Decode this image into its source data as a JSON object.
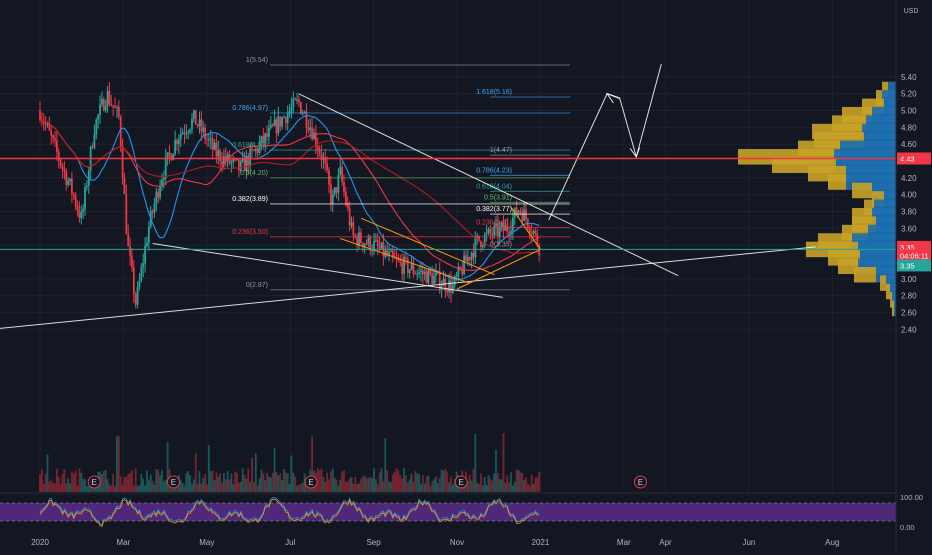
{
  "currency": "USD",
  "price_axis": {
    "ticks": [
      {
        "label": "5.40",
        "v": 5.4
      },
      {
        "label": "5.20",
        "v": 5.2
      },
      {
        "label": "5.00",
        "v": 5.0
      },
      {
        "label": "4.80",
        "v": 4.8
      },
      {
        "label": "4.60",
        "v": 4.6
      },
      {
        "label": "4.20",
        "v": 4.2
      },
      {
        "label": "4.00",
        "v": 4.0
      },
      {
        "label": "3.80",
        "v": 3.8
      },
      {
        "label": "3.60",
        "v": 3.6
      },
      {
        "label": "3.40",
        "v": 3.4
      },
      {
        "label": "3.00",
        "v": 3.0
      },
      {
        "label": "2.80",
        "v": 2.8
      },
      {
        "label": "2.60",
        "v": 2.6
      },
      {
        "label": "2.40",
        "v": 2.4
      }
    ],
    "badges": [
      {
        "label": "4.43",
        "v": 4.43,
        "color": "#f23645"
      },
      {
        "label": "3.35",
        "v": 3.38,
        "color": "#f23645"
      },
      {
        "label": "04:06:11",
        "v": 3.28,
        "color": "#f23645"
      },
      {
        "label": "3.35",
        "v": 3.16,
        "color": "#26a69a"
      }
    ]
  },
  "time_axis": {
    "labels": [
      {
        "label": "2020",
        "m": 0
      },
      {
        "label": "Mar",
        "m": 2
      },
      {
        "label": "May",
        "m": 4
      },
      {
        "label": "Jul",
        "m": 6
      },
      {
        "label": "Sep",
        "m": 8
      },
      {
        "label": "Nov",
        "m": 10
      },
      {
        "label": "2021",
        "m": 12
      },
      {
        "label": "Mar",
        "m": 14
      },
      {
        "label": "Apr",
        "m": 15
      },
      {
        "label": "Jun",
        "m": 17
      },
      {
        "label": "Aug",
        "m": 19
      }
    ]
  },
  "rsi_axis": {
    "ticks": [
      {
        "label": "100.00",
        "v": 100
      },
      {
        "label": "0.00",
        "v": 0
      }
    ]
  },
  "fib_left": {
    "color": "#9598a1",
    "levels": [
      {
        "label": "1(5.54)",
        "v": 5.54,
        "color": "#9598a1"
      },
      {
        "label": "0.786(4.97)",
        "v": 4.97,
        "color": "#42a5f5"
      },
      {
        "label": "0.618(4.53)",
        "v": 4.53,
        "color": "#26a69a"
      },
      {
        "label": "0.5(4.20)",
        "v": 4.2,
        "color": "#66bb6a"
      },
      {
        "label": "0.382(3.89)",
        "v": 3.89,
        "color": "#ffffff"
      },
      {
        "label": "0.236(3.50)",
        "v": 3.5,
        "color": "#f23645"
      },
      {
        "label": "0(2.87)",
        "v": 2.87,
        "color": "#9598a1"
      }
    ]
  },
  "fib_right": {
    "levels": [
      {
        "label": "1.618(5.16)",
        "v": 5.16,
        "color": "#42a5f5"
      },
      {
        "label": "1(4.47)",
        "v": 4.47,
        "color": "#9598a1"
      },
      {
        "label": "0.786(4.23)",
        "v": 4.23,
        "color": "#42a5f5"
      },
      {
        "label": "0.618(4.04)",
        "v": 4.04,
        "color": "#26a69a"
      },
      {
        "label": "0.5(3.91)",
        "v": 3.91,
        "color": "#66bb6a"
      },
      {
        "label": "0.382(3.77)",
        "v": 3.77,
        "color": "#ffffff"
      },
      {
        "label": "0.236(3.61)",
        "v": 3.61,
        "color": "#f23645"
      },
      {
        "label": "0(3.35)",
        "v": 3.35,
        "color": "#9598a1"
      }
    ]
  },
  "horizontal_lines": [
    {
      "name": "resistance",
      "v": 4.43,
      "color": "#f23645"
    },
    {
      "name": "current-price",
      "v": 3.35,
      "color": "#26a69a"
    }
  ],
  "earnings_markers": {
    "label": "E",
    "months": [
      1.3,
      3.2,
      6.5,
      10.1,
      14.4
    ]
  },
  "colors": {
    "up": "#26a69a",
    "down": "#f23645",
    "bg": "#131722",
    "grid": "#1e222d",
    "axis_text": "#b2b5be",
    "ma_blue": "#2196f3",
    "ma_red": "#f23645",
    "ma_dark_red": "#b71c1c",
    "vp_gold": "#c9a227",
    "vp_blue": "#1e6fb0",
    "rsi_fill": "#5b2b8a"
  },
  "chart_data": {
    "type": "candlestick",
    "x_unit": "months since Jan 2020",
    "price_path": [
      [
        0,
        5.0
      ],
      [
        0.4,
        4.5
      ],
      [
        0.8,
        4.0
      ],
      [
        1.0,
        3.7
      ],
      [
        1.3,
        4.8
      ],
      [
        1.6,
        5.2
      ],
      [
        1.9,
        4.9
      ],
      [
        2.1,
        3.4
      ],
      [
        2.3,
        2.7
      ],
      [
        2.6,
        3.6
      ],
      [
        2.9,
        4.2
      ],
      [
        3.3,
        4.7
      ],
      [
        3.7,
        4.9
      ],
      [
        4.2,
        4.5
      ],
      [
        4.8,
        4.3
      ],
      [
        5.3,
        4.6
      ],
      [
        5.8,
        4.9
      ],
      [
        6.2,
        5.1
      ],
      [
        6.5,
        4.8
      ],
      [
        6.8,
        4.4
      ],
      [
        7.0,
        3.9
      ],
      [
        7.2,
        4.25
      ],
      [
        7.5,
        3.5
      ],
      [
        8.0,
        3.4
      ],
      [
        8.5,
        3.2
      ],
      [
        9.0,
        3.1
      ],
      [
        9.5,
        3.0
      ],
      [
        9.9,
        2.9
      ],
      [
        10.2,
        3.2
      ],
      [
        10.5,
        3.45
      ],
      [
        10.9,
        3.55
      ],
      [
        11.2,
        3.6
      ],
      [
        11.5,
        3.85
      ],
      [
        11.8,
        3.6
      ],
      [
        12.0,
        3.35
      ]
    ],
    "volume_profile": [
      {
        "v": 5.25,
        "buy": 6,
        "sell": 8
      },
      {
        "v": 5.15,
        "buy": 6,
        "sell": 14
      },
      {
        "v": 5.05,
        "buy": 22,
        "sell": 12
      },
      {
        "v": 4.95,
        "buy": 30,
        "sell": 24
      },
      {
        "v": 4.85,
        "buy": 34,
        "sell": 30
      },
      {
        "v": 4.75,
        "buy": 50,
        "sell": 34
      },
      {
        "v": 4.65,
        "buy": 50,
        "sell": 32
      },
      {
        "v": 4.55,
        "buy": 42,
        "sell": 56
      },
      {
        "v": 4.45,
        "buy": 96,
        "sell": 62
      },
      {
        "v": 4.35,
        "buy": 64,
        "sell": 60
      },
      {
        "v": 4.25,
        "buy": 38,
        "sell": 50
      },
      {
        "v": 4.15,
        "buy": 18,
        "sell": 50
      },
      {
        "v": 4.05,
        "buy": 20,
        "sell": 24
      },
      {
        "v": 3.95,
        "buy": 12,
        "sell": 12
      },
      {
        "v": 3.85,
        "buy": 10,
        "sell": 22
      },
      {
        "v": 3.75,
        "buy": 20,
        "sell": 24
      },
      {
        "v": 3.65,
        "buy": 24,
        "sell": 20
      },
      {
        "v": 3.55,
        "buy": 26,
        "sell": 28
      },
      {
        "v": 3.45,
        "buy": 34,
        "sell": 44
      },
      {
        "v": 3.35,
        "buy": 52,
        "sell": 38
      },
      {
        "v": 3.25,
        "buy": 32,
        "sell": 36
      },
      {
        "v": 3.15,
        "buy": 20,
        "sell": 38
      },
      {
        "v": 3.05,
        "buy": 22,
        "sell": 20
      },
      {
        "v": 2.95,
        "buy": 6,
        "sell": 10
      },
      {
        "v": 2.85,
        "buy": 4,
        "sell": 6
      },
      {
        "v": 2.75,
        "buy": 2,
        "sell": 4
      },
      {
        "v": 2.65,
        "buy": 2,
        "sell": 2
      }
    ]
  }
}
